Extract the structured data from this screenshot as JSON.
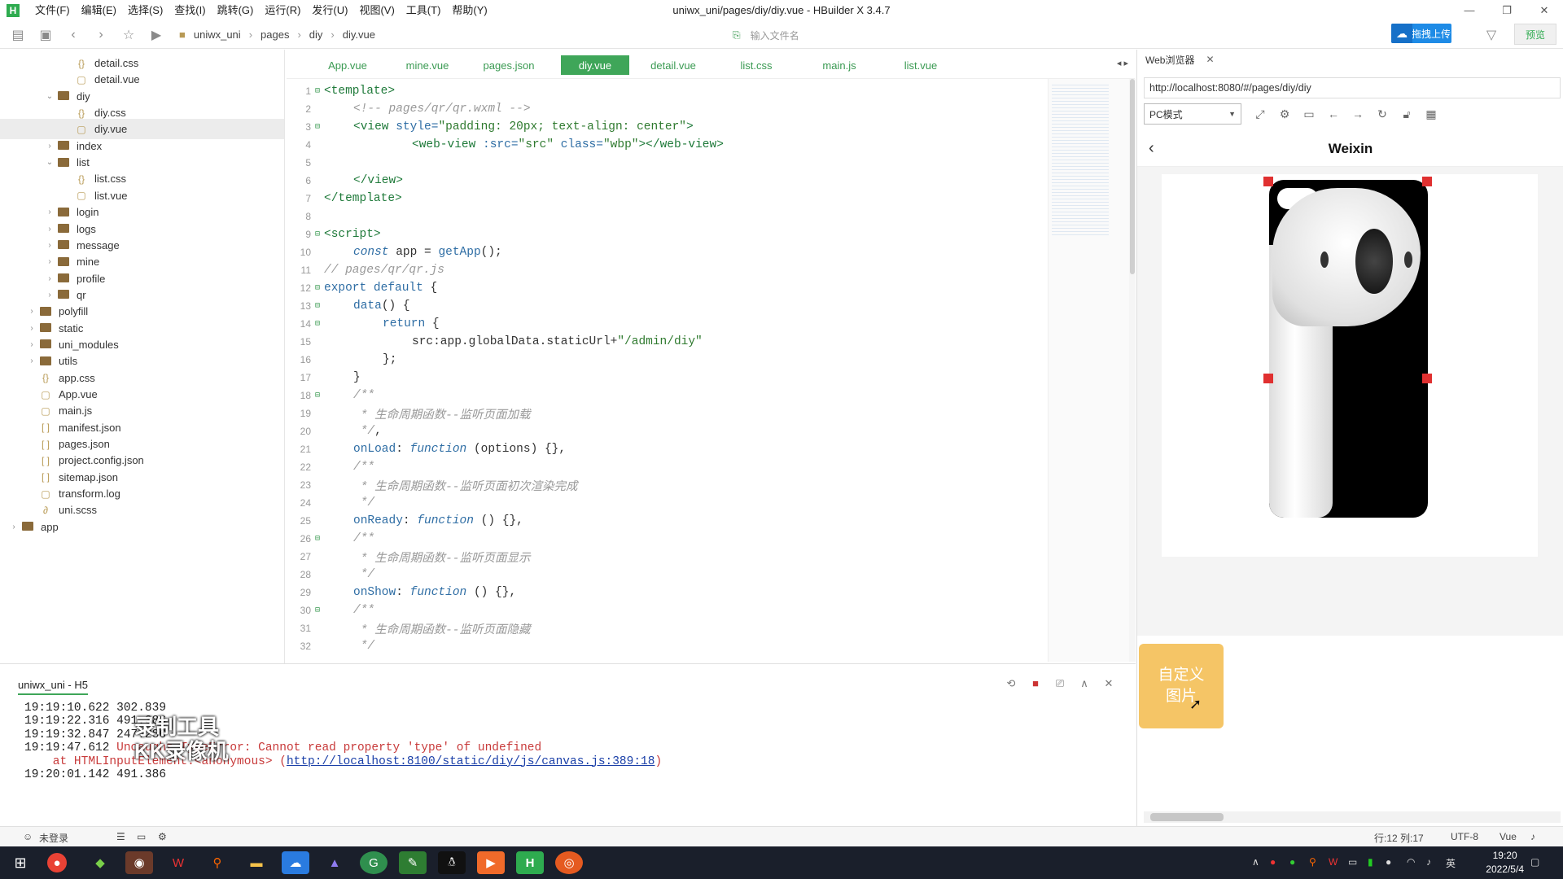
{
  "window": {
    "title": "uniwx_uni/pages/diy/diy.vue - HBuilder X 3.4.7",
    "menu": [
      "文件(F)",
      "编辑(E)",
      "选择(S)",
      "查找(I)",
      "跳转(G)",
      "运行(R)",
      "发行(U)",
      "视图(V)",
      "工具(T)",
      "帮助(Y)"
    ]
  },
  "toolbar": {
    "breadcrumb": [
      "uniwx_uni",
      "pages",
      "diy",
      "diy.vue"
    ],
    "file_search_placeholder": "输入文件名",
    "upload_label": "拖拽上传",
    "preview_label": "预览"
  },
  "sidebar": {
    "items": [
      {
        "label": "detail.css",
        "type": "file-css",
        "depth": 4,
        "arrow": ""
      },
      {
        "label": "detail.vue",
        "type": "file-vue",
        "depth": 4,
        "arrow": ""
      },
      {
        "label": "diy",
        "type": "folder",
        "depth": 3,
        "arrow": "open"
      },
      {
        "label": "diy.css",
        "type": "file-css",
        "depth": 4,
        "arrow": ""
      },
      {
        "label": "diy.vue",
        "type": "file-vue",
        "depth": 4,
        "arrow": "",
        "selected": true
      },
      {
        "label": "index",
        "type": "folder",
        "depth": 3,
        "arrow": "closed"
      },
      {
        "label": "list",
        "type": "folder",
        "depth": 3,
        "arrow": "open"
      },
      {
        "label": "list.css",
        "type": "file-css",
        "depth": 4,
        "arrow": ""
      },
      {
        "label": "list.vue",
        "type": "file-vue",
        "depth": 4,
        "arrow": ""
      },
      {
        "label": "login",
        "type": "folder",
        "depth": 3,
        "arrow": "closed"
      },
      {
        "label": "logs",
        "type": "folder",
        "depth": 3,
        "arrow": "closed"
      },
      {
        "label": "message",
        "type": "folder",
        "depth": 3,
        "arrow": "closed"
      },
      {
        "label": "mine",
        "type": "folder",
        "depth": 3,
        "arrow": "closed"
      },
      {
        "label": "profile",
        "type": "folder",
        "depth": 3,
        "arrow": "closed"
      },
      {
        "label": "qr",
        "type": "folder",
        "depth": 3,
        "arrow": "closed"
      },
      {
        "label": "polyfill",
        "type": "folder",
        "depth": 2,
        "arrow": "closed"
      },
      {
        "label": "static",
        "type": "folder",
        "depth": 2,
        "arrow": "closed"
      },
      {
        "label": "uni_modules",
        "type": "folder",
        "depth": 2,
        "arrow": "closed"
      },
      {
        "label": "utils",
        "type": "folder",
        "depth": 2,
        "arrow": "closed"
      },
      {
        "label": "app.css",
        "type": "file-css",
        "depth": 2,
        "arrow": ""
      },
      {
        "label": "App.vue",
        "type": "file-vue",
        "depth": 2,
        "arrow": ""
      },
      {
        "label": "main.js",
        "type": "file-js",
        "depth": 2,
        "arrow": ""
      },
      {
        "label": "manifest.json",
        "type": "file-json",
        "depth": 2,
        "arrow": ""
      },
      {
        "label": "pages.json",
        "type": "file-json",
        "depth": 2,
        "arrow": ""
      },
      {
        "label": "project.config.json",
        "type": "file-json",
        "depth": 2,
        "arrow": ""
      },
      {
        "label": "sitemap.json",
        "type": "file-json",
        "depth": 2,
        "arrow": ""
      },
      {
        "label": "transform.log",
        "type": "file-log",
        "depth": 2,
        "arrow": ""
      },
      {
        "label": "uni.scss",
        "type": "file-scss",
        "depth": 2,
        "arrow": ""
      },
      {
        "label": "app",
        "type": "folder",
        "depth": 1,
        "arrow": "closed"
      }
    ]
  },
  "editor": {
    "tabs": [
      "App.vue",
      "mine.vue",
      "pages.json",
      "diy.vue",
      "detail.vue",
      "list.css",
      "main.js",
      "list.vue"
    ],
    "active_tab": "diy.vue",
    "lines": [
      {
        "n": "1",
        "fold": "⊟",
        "indent": 0,
        "segs": [
          [
            "tag",
            "<template>"
          ]
        ]
      },
      {
        "n": "2",
        "fold": "",
        "indent": 1,
        "segs": [
          [
            "cmt",
            "<!-- pages/qr/qr.wxml -->"
          ]
        ]
      },
      {
        "n": "3",
        "fold": "⊟",
        "indent": 1,
        "segs": [
          [
            "tag",
            "<view "
          ],
          [
            "attr",
            "style="
          ],
          [
            "str",
            "\"padding: 20px; text-align: center\""
          ],
          [
            "tag",
            ">"
          ]
        ]
      },
      {
        "n": "4",
        "fold": "",
        "indent": 3,
        "segs": [
          [
            "tag",
            "<web-view "
          ],
          [
            "attr",
            ":src="
          ],
          [
            "str",
            "\"src\" "
          ],
          [
            "attr",
            "class="
          ],
          [
            "str",
            "\"wbp\""
          ],
          [
            "tag",
            "></web-view>"
          ]
        ]
      },
      {
        "n": "5",
        "fold": "",
        "indent": 0,
        "segs": []
      },
      {
        "n": "6",
        "fold": "",
        "indent": 1,
        "segs": [
          [
            "tag",
            "</view>"
          ]
        ]
      },
      {
        "n": "7",
        "fold": "",
        "indent": 0,
        "segs": [
          [
            "tag",
            "</template>"
          ]
        ]
      },
      {
        "n": "8",
        "fold": "",
        "indent": 0,
        "segs": []
      },
      {
        "n": "9",
        "fold": "⊟",
        "indent": 0,
        "segs": [
          [
            "tag",
            "<script>"
          ]
        ]
      },
      {
        "n": "10",
        "fold": "",
        "indent": 1,
        "segs": [
          [
            "kwi",
            "const "
          ],
          [
            "id",
            "app = "
          ],
          [
            "fn",
            "getApp"
          ],
          [
            "id",
            "();"
          ]
        ]
      },
      {
        "n": "11",
        "fold": "",
        "indent": 0,
        "segs": [
          [
            "cmt",
            "// pages/qr/qr.js"
          ]
        ]
      },
      {
        "n": "12",
        "fold": "⊟",
        "indent": 0,
        "segs": [
          [
            "kw",
            "export default "
          ],
          [
            "id",
            "{"
          ]
        ]
      },
      {
        "n": "13",
        "fold": "⊟",
        "indent": 1,
        "segs": [
          [
            "fn",
            "data"
          ],
          [
            "id",
            "() {"
          ]
        ]
      },
      {
        "n": "14",
        "fold": "⊟",
        "indent": 2,
        "segs": [
          [
            "kw",
            "return "
          ],
          [
            "id",
            "{"
          ]
        ]
      },
      {
        "n": "15",
        "fold": "",
        "indent": 3,
        "segs": [
          [
            "id",
            "src:app.globalData.staticUrl+"
          ],
          [
            "str",
            "\"/admin/diy\""
          ]
        ]
      },
      {
        "n": "16",
        "fold": "",
        "indent": 2,
        "segs": [
          [
            "id",
            "};"
          ]
        ]
      },
      {
        "n": "17",
        "fold": "",
        "indent": 1,
        "segs": [
          [
            "id",
            "}"
          ]
        ]
      },
      {
        "n": "18",
        "fold": "⊟",
        "indent": 1,
        "segs": [
          [
            "cmt",
            "/**"
          ]
        ]
      },
      {
        "n": "19",
        "fold": "",
        "indent": 1,
        "segs": [
          [
            "cmt",
            " * 生命周期函数--监听页面加载"
          ]
        ]
      },
      {
        "n": "20",
        "fold": "",
        "indent": 1,
        "segs": [
          [
            "cmt",
            " */"
          ],
          [
            "id",
            ","
          ]
        ]
      },
      {
        "n": "21",
        "fold": "",
        "indent": 1,
        "segs": [
          [
            "fn",
            "onLoad"
          ],
          [
            "id",
            ": "
          ],
          [
            "kwi",
            "function "
          ],
          [
            "id",
            "(options) {},"
          ]
        ]
      },
      {
        "n": "22",
        "fold": "",
        "indent": 1,
        "segs": [
          [
            "cmt",
            "/**"
          ]
        ]
      },
      {
        "n": "23",
        "fold": "",
        "indent": 1,
        "segs": [
          [
            "cmt",
            " * 生命周期函数--监听页面初次渲染完成"
          ]
        ]
      },
      {
        "n": "24",
        "fold": "",
        "indent": 1,
        "segs": [
          [
            "cmt",
            " */"
          ]
        ]
      },
      {
        "n": "25",
        "fold": "",
        "indent": 1,
        "segs": [
          [
            "fn",
            "onReady"
          ],
          [
            "id",
            ": "
          ],
          [
            "kwi",
            "function "
          ],
          [
            "id",
            "() {},"
          ]
        ]
      },
      {
        "n": "26",
        "fold": "⊟",
        "indent": 1,
        "segs": [
          [
            "cmt",
            "/**"
          ]
        ]
      },
      {
        "n": "27",
        "fold": "",
        "indent": 1,
        "segs": [
          [
            "cmt",
            " * 生命周期函数--监听页面显示"
          ]
        ]
      },
      {
        "n": "28",
        "fold": "",
        "indent": 1,
        "segs": [
          [
            "cmt",
            " */"
          ]
        ]
      },
      {
        "n": "29",
        "fold": "",
        "indent": 1,
        "segs": [
          [
            "fn",
            "onShow"
          ],
          [
            "id",
            ": "
          ],
          [
            "kwi",
            "function "
          ],
          [
            "id",
            "() {},"
          ]
        ]
      },
      {
        "n": "30",
        "fold": "⊟",
        "indent": 1,
        "segs": [
          [
            "cmt",
            "/**"
          ]
        ]
      },
      {
        "n": "31",
        "fold": "",
        "indent": 1,
        "segs": [
          [
            "cmt",
            " * 生命周期函数--监听页面隐藏"
          ]
        ]
      },
      {
        "n": "32",
        "fold": "",
        "indent": 1,
        "segs": [
          [
            "cmt",
            " */"
          ]
        ]
      }
    ]
  },
  "browser": {
    "tab_label": "Web浏览器",
    "url": "http://localhost:8080/#/pages/diy/diy",
    "mode": "PC模式",
    "page_title": "Weixin",
    "diy_button": "自定义图片"
  },
  "console": {
    "title": "uniwx_uni - H5",
    "lines": [
      {
        "time": "19:19:10.622",
        "text": " 302.839",
        "err": false
      },
      {
        "time": "19:19:22.316",
        "text": " 491.386",
        "err": false
      },
      {
        "time": "19:19:32.847",
        "text": " 247.286",
        "err": false
      },
      {
        "time": "19:19:47.612",
        "text": " Uncaught TypeError: Cannot read property 'type' of undefined",
        "err": true
      },
      {
        "time": "",
        "text": "    at HTMLInputElement.<anonymous> (",
        "err": true,
        "link": "http://localhost:8100/static/diy/js/canvas.js:389:18",
        "tail": ")"
      },
      {
        "time": "19:20:01.142",
        "text": " 491.386",
        "err": false
      }
    ],
    "watermark_line1": "录制工具",
    "watermark_line2": "KK录像机"
  },
  "statusbar": {
    "login": "未登录",
    "position": "行:12   列:17",
    "encoding": "UTF-8",
    "language": "Vue"
  },
  "taskbar": {
    "time": "19:20",
    "date": "2022/5/4",
    "ime": "英"
  },
  "colors": {
    "accent": "#3fa659",
    "diy_button": "#f5c566",
    "upload": "#1e8be6",
    "error": "#c83a3a"
  }
}
